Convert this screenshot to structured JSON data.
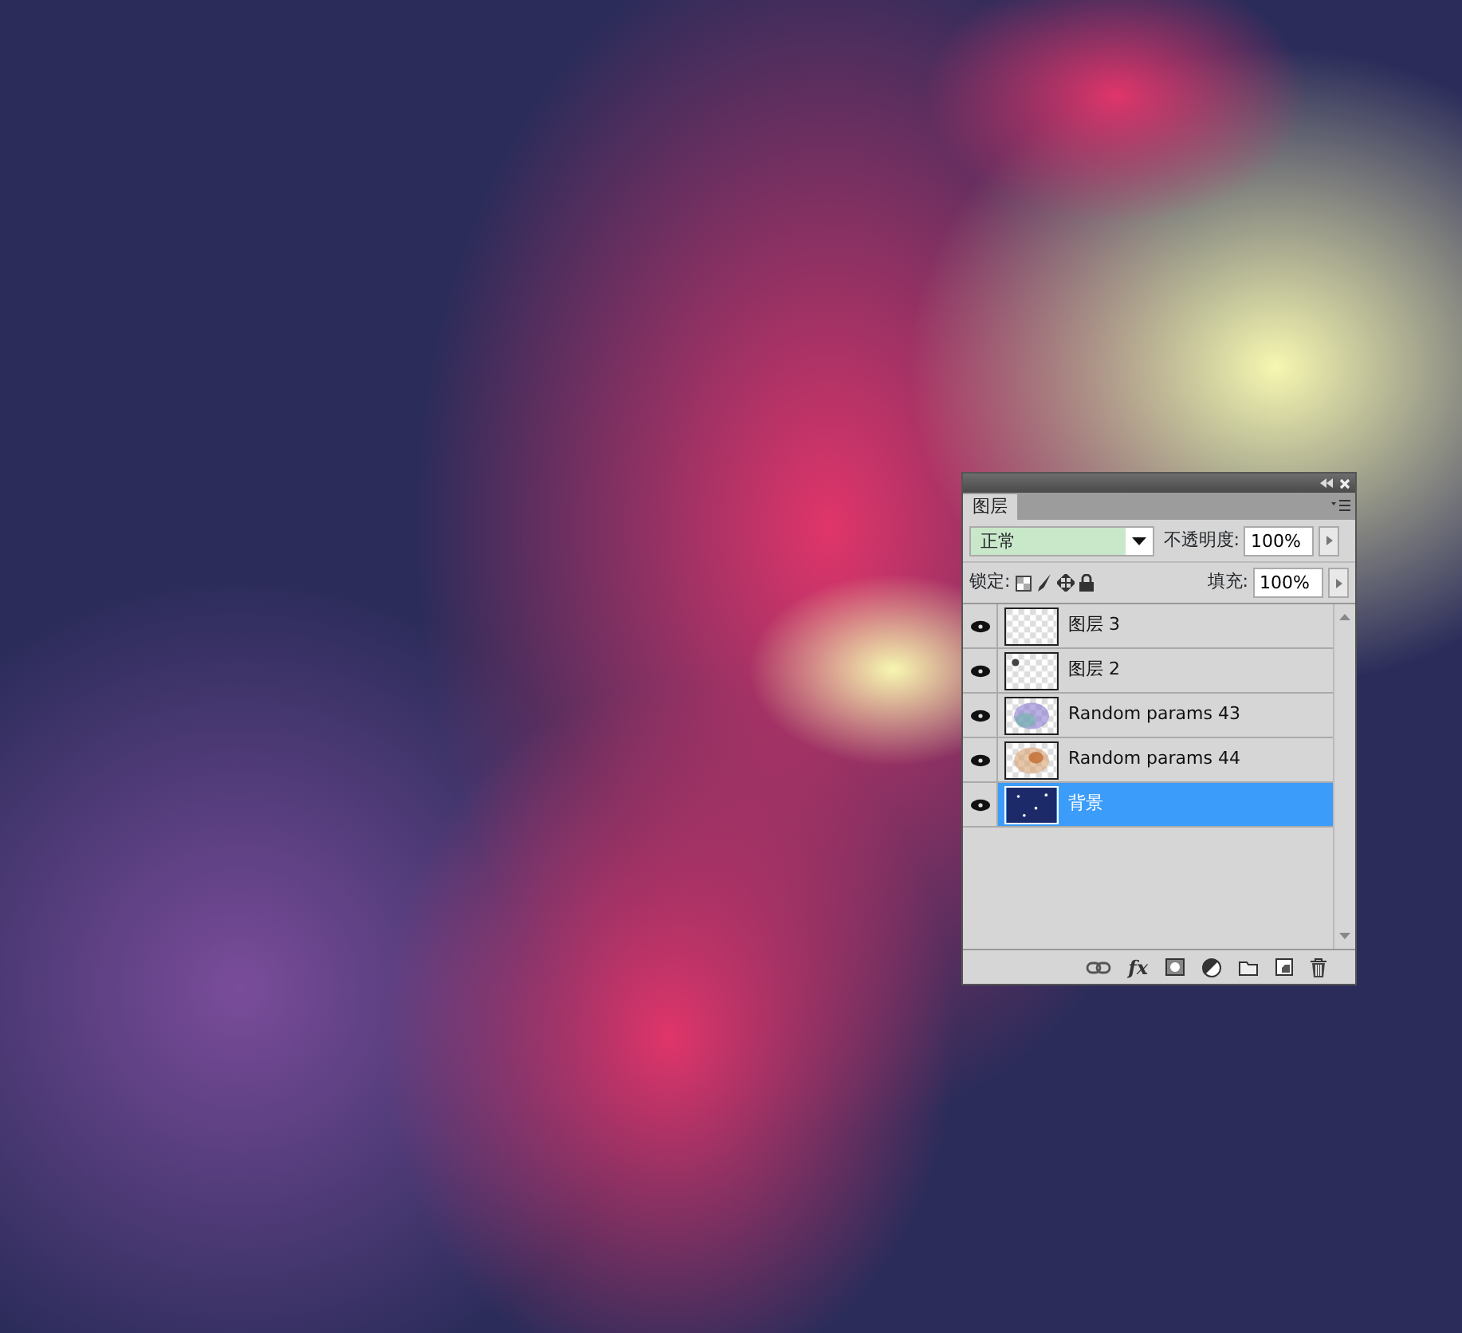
{
  "layers_panel": {
    "tab": "图层",
    "blend_mode": "正常",
    "opacity_label": "不透明度:",
    "opacity": "100%",
    "lock_label": "锁定:",
    "fill_label": "填充:",
    "fill": "100%",
    "layers": [
      {
        "name": "图层 3",
        "kind": "empty",
        "visible": true,
        "selected": false
      },
      {
        "name": "图层 2",
        "kind": "dot",
        "visible": true,
        "selected": false
      },
      {
        "name": "Random params 43",
        "kind": "blue",
        "visible": true,
        "selected": false
      },
      {
        "name": "Random params 44",
        "kind": "orange",
        "visible": true,
        "selected": false
      },
      {
        "name": "背景",
        "kind": "stars",
        "visible": true,
        "selected": true
      }
    ],
    "footer_buttons": [
      {
        "kind": "link"
      },
      {
        "kind": "fx",
        "label": "fx"
      },
      {
        "kind": "mask"
      },
      {
        "kind": "adjust"
      },
      {
        "kind": "folder"
      },
      {
        "kind": "new"
      },
      {
        "kind": "trash"
      }
    ]
  }
}
